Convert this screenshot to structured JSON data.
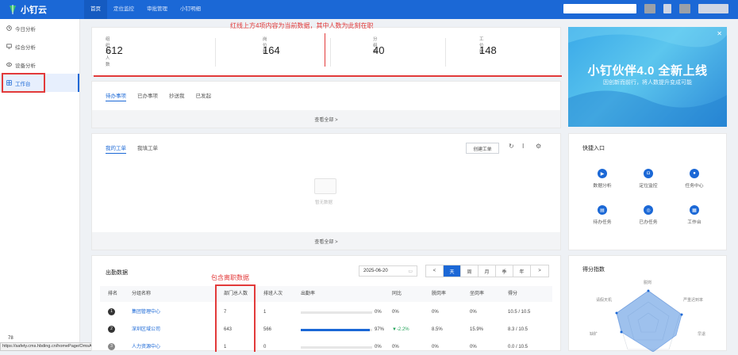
{
  "app": {
    "title": "小钉云"
  },
  "nav": {
    "items": [
      "首页",
      "定位监控",
      "审批管理",
      "小钉明细"
    ]
  },
  "sidebar": {
    "items": [
      {
        "label": "今日分析",
        "icon": "clock-icon"
      },
      {
        "label": "综合分析",
        "icon": "monitor-icon"
      },
      {
        "label": "设备分析",
        "icon": "device-icon"
      },
      {
        "label": "工作台",
        "icon": "grid-icon"
      }
    ]
  },
  "stats": [
    {
      "label": "组织总人数",
      "value": "612"
    },
    {
      "label": "岗位数",
      "value": "164"
    },
    {
      "label": "分组数",
      "value": "40"
    },
    {
      "label": "工位数",
      "value": "148"
    }
  ],
  "annotations": {
    "top_note": "红线上方4项内容为当前数据，其中人数为此刻在职",
    "table_note": "包含离职数据"
  },
  "todo": {
    "tabs": [
      "待办事项",
      "已办事项",
      "抄送我",
      "已发起"
    ],
    "view_all": "查看全部 >"
  },
  "workorder": {
    "tabs": [
      "我的工单",
      "我填工单"
    ],
    "create_label": "创建工单",
    "empty_text": "暂无数据",
    "view_all": "查看全部 >"
  },
  "attendance": {
    "title": "出勤数据",
    "date": "2025-06-20",
    "periods": [
      "天",
      "周",
      "月",
      "季",
      "年"
    ],
    "columns": [
      "排名",
      "分组名称",
      "部门总人数",
      "排班人次",
      "出勤率",
      "同比",
      "脱岗率",
      "坐岗率",
      "得分"
    ],
    "rows": [
      {
        "rank": "1",
        "name": "集团管理中心",
        "total": "7",
        "shifts": "1",
        "rate": "0%",
        "rate_value": 0,
        "yoy": "0%",
        "off": "0%",
        "on": "0%",
        "score": "10.5 / 10.5"
      },
      {
        "rank": "2",
        "name": "深圳区域公司",
        "total": "643",
        "shifts": "566",
        "rate": "97%",
        "rate_value": 97,
        "yoy": "▼-2.2%",
        "off": "8.5%",
        "on": "15.9%",
        "score": "8.3 / 10.5"
      },
      {
        "rank": "3",
        "name": "人力资源中心",
        "total": "1",
        "shifts": "0",
        "rate": "0%",
        "rate_value": 0,
        "yoy": "0%",
        "off": "0%",
        "on": "0%",
        "score": "0.0 / 10.5"
      }
    ]
  },
  "banner": {
    "title": "小钉伙伴4.0 全新上线",
    "subtitle": "因创新而前行，将人数提升变成可能"
  },
  "quick": {
    "title": "快捷入口",
    "items": [
      {
        "label": "数据分析",
        "icon": "play-icon"
      },
      {
        "label": "定位监控",
        "icon": "camera-icon"
      },
      {
        "label": "任务中心",
        "icon": "user-icon"
      },
      {
        "label": "待办任务",
        "icon": "clipboard-icon"
      },
      {
        "label": "已办任务",
        "icon": "check-circle-icon"
      },
      {
        "label": "工作台",
        "icon": "grid-icon"
      }
    ]
  },
  "score": {
    "title": "得分指数",
    "labels": [
      "脱岗",
      "严重迟到率",
      "早退",
      "缺旷",
      "请假天机"
    ]
  },
  "statusbar": {
    "url": "https://safety.cms.hbding.cn/homePage/OmsAnalysis",
    "code": "78"
  },
  "colors": {
    "brand": "#1b68d6",
    "annotation": "#e23a3a"
  }
}
